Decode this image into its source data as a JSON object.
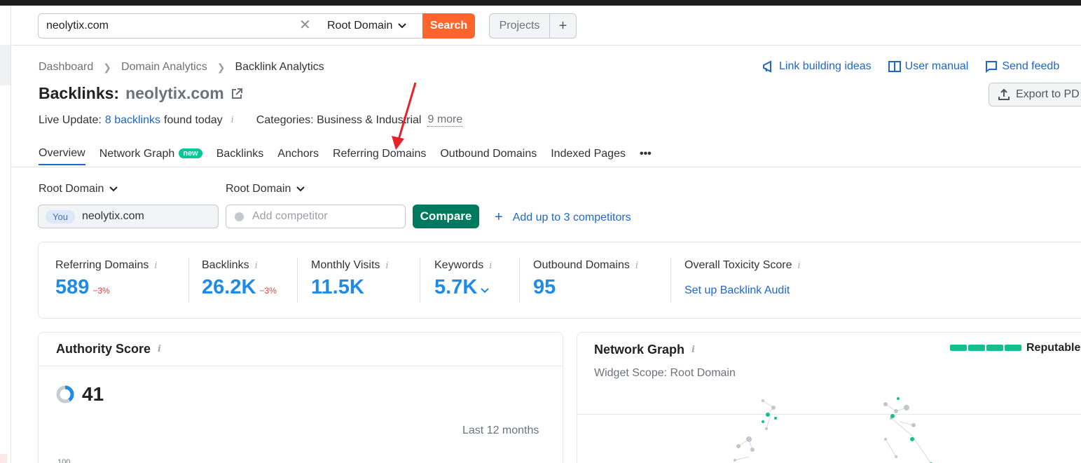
{
  "search": {
    "value": "neolytix.com",
    "scope": "Root Domain",
    "button": "Search",
    "projects": "Projects",
    "projects_add": "+"
  },
  "breadcrumbs": [
    "Dashboard",
    "Domain Analytics",
    "Backlink Analytics"
  ],
  "top_links": {
    "link_building": "Link building ideas",
    "user_manual": "User manual",
    "send_feedback": "Send feedb",
    "export": "Export to PD"
  },
  "header": {
    "title_prefix": "Backlinks:",
    "domain": "neolytix.com",
    "live_update_label": "Live Update:",
    "live_update_count": "8 backlinks",
    "live_update_suffix": "found today",
    "categories_label": "Categories: Business & Industrial",
    "categories_more": "9 more"
  },
  "tabs": [
    {
      "label": "Overview",
      "active": true
    },
    {
      "label": "Network Graph",
      "badge": "new"
    },
    {
      "label": "Backlinks"
    },
    {
      "label": "Anchors"
    },
    {
      "label": "Referring Domains"
    },
    {
      "label": "Outbound Domains"
    },
    {
      "label": "Indexed Pages"
    },
    {
      "label": "•••"
    }
  ],
  "compare": {
    "left_scope": "Root Domain",
    "right_scope": "Root Domain",
    "you_tag": "You",
    "you_domain": "neolytix.com",
    "competitor_placeholder": "Add competitor",
    "compare_button": "Compare",
    "add_competitors": "Add up to 3 competitors"
  },
  "metrics": [
    {
      "label": "Referring Domains",
      "value": "589",
      "delta": "−3%"
    },
    {
      "label": "Backlinks",
      "value": "26.2K",
      "delta": "−3%"
    },
    {
      "label": "Monthly Visits",
      "value": "11.5K"
    },
    {
      "label": "Keywords",
      "value": "5.7K"
    },
    {
      "label": "Outbound Domains",
      "value": "95"
    },
    {
      "label": "Overall Toxicity Score",
      "link": "Set up Backlink Audit"
    }
  ],
  "authority": {
    "title": "Authority Score",
    "score": "41",
    "period": "Last 12 months",
    "axis_tick": "100"
  },
  "network": {
    "title": "Network Graph",
    "scope": "Widget Scope: Root Domain",
    "status": "Reputable"
  },
  "colors": {
    "accent": "#1f67c6",
    "search_button": "#ff642d",
    "compare_button": "#007a5e",
    "metric_value": "#1f8be6",
    "negative": "#e33b3b",
    "reputable": "#13c08c"
  }
}
